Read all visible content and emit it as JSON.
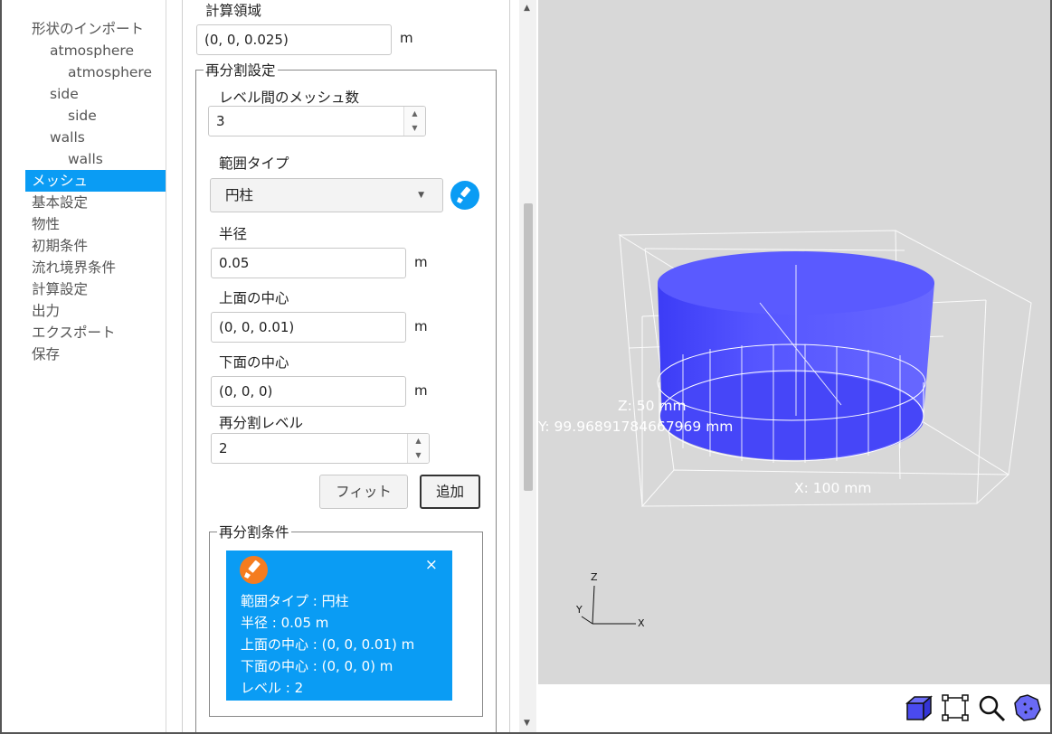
{
  "sidebar": {
    "items": [
      {
        "label": "形状のインポート",
        "level": 0
      },
      {
        "label": "atmosphere",
        "level": 1
      },
      {
        "label": "atmosphere",
        "level": 2
      },
      {
        "label": "side",
        "level": 1
      },
      {
        "label": "side",
        "level": 2
      },
      {
        "label": "walls",
        "level": 1
      },
      {
        "label": "walls",
        "level": 2
      },
      {
        "label": "メッシュ",
        "level": 0,
        "selected": true
      },
      {
        "label": "基本設定",
        "level": 0
      },
      {
        "label": "物性",
        "level": 0
      },
      {
        "label": "初期条件",
        "level": 0
      },
      {
        "label": "流れ境界条件",
        "level": 0
      },
      {
        "label": "計算設定",
        "level": 0
      },
      {
        "label": "出力",
        "level": 0
      },
      {
        "label": "エクスポート",
        "level": 0
      },
      {
        "label": "保存",
        "level": 0
      }
    ]
  },
  "form": {
    "domain_label": "計算領域",
    "domain_value": "(0, 0, 0.025)",
    "domain_unit": "m",
    "refine_legend": "再分割設定",
    "mesh_between_label": "レベル間のメッシュ数",
    "mesh_between_value": "3",
    "range_type_label": "範囲タイプ",
    "range_type_value": "円柱",
    "radius_label": "半径",
    "radius_value": "0.05",
    "radius_unit": "m",
    "top_center_label": "上面の中心",
    "top_center_value": "(0, 0, 0.01)",
    "top_center_unit": "m",
    "bottom_center_label": "下面の中心",
    "bottom_center_value": "(0, 0, 0)",
    "bottom_center_unit": "m",
    "level_label": "再分割レベル",
    "level_value": "2",
    "fit_button": "フィット",
    "add_button": "追加",
    "conditions_legend": "再分割条件",
    "condition_card": {
      "close": "×",
      "lines": [
        "範囲タイプ : 円柱",
        "半径 : 0.05 m",
        "上面の中心 : (0, 0, 0.01) m",
        "下面の中心 : (0, 0, 0) m",
        "レベル : 2"
      ]
    }
  },
  "viewer": {
    "z_dim": "Z: 50 mm",
    "y_dim": "Y: 99.96891784667969 mm",
    "x_dim": "X: 100 mm",
    "axis_z": "Z",
    "axis_y": "Y",
    "axis_x": "X",
    "colors": {
      "background": "#d8d8d8",
      "cylinder": "#5050ff",
      "accent": "#0a9cf4"
    }
  },
  "toolbar": {
    "icons": [
      "view-cube-icon",
      "fit-bounds-icon",
      "zoom-icon",
      "rotate-sphere-icon"
    ]
  }
}
